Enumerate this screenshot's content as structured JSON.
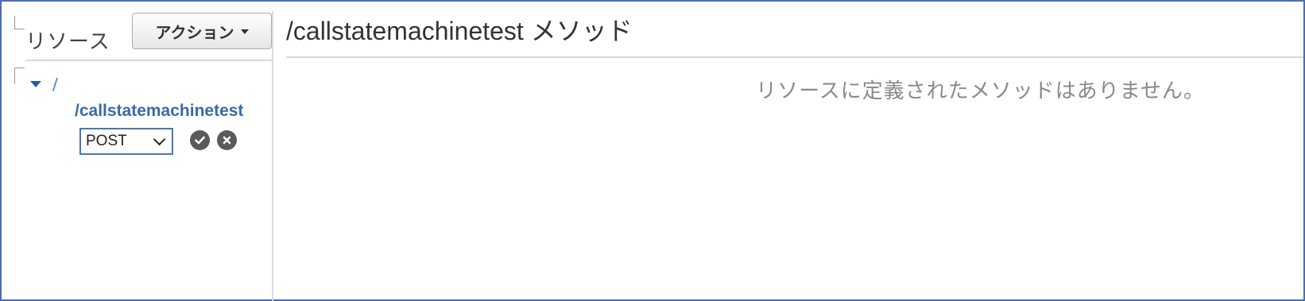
{
  "sidebar": {
    "title": "リソース",
    "action_button": "アクション",
    "tree": {
      "root": "/",
      "child": "/callstatemachinetest"
    },
    "method_select": {
      "selected": "POST"
    }
  },
  "main": {
    "title": "/callstatemachinetest メソッド",
    "empty_message": "リソースに定義されたメソッドはありません。"
  },
  "colors": {
    "accent": "#3b6aa9",
    "frame_border": "#4a6fb3",
    "icon_button": "#5a5a5a"
  }
}
